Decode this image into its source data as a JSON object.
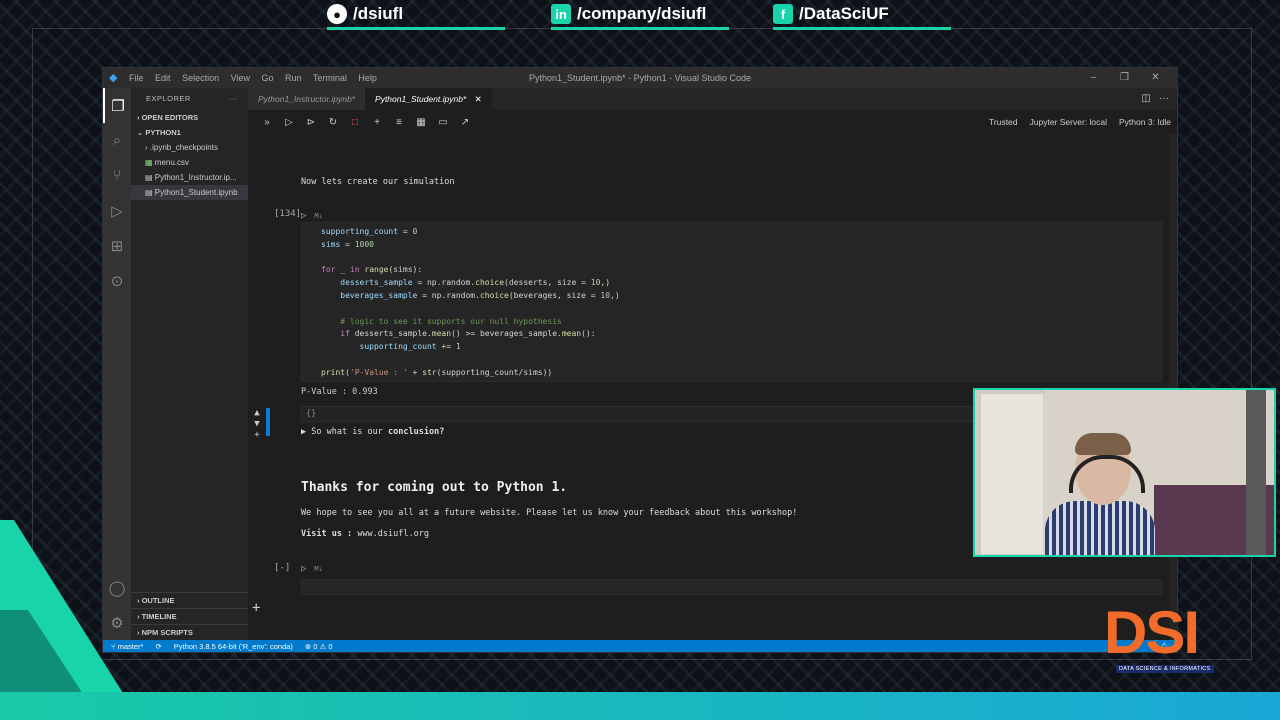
{
  "overlay": {
    "social": [
      {
        "icon": "github-icon",
        "text": "/dsiufl"
      },
      {
        "icon": "linkedin-icon",
        "text": "/company/dsiufl"
      },
      {
        "icon": "facebook-icon",
        "text": "/DataSciUF"
      }
    ],
    "logo_text": "DSI",
    "logo_sub": "DATA SCIENCE & INFORMATICS",
    "accent_color": "#19d3aa",
    "logo_color": "#f36b2a"
  },
  "window": {
    "title": "Python1_Student.ipynb* - Python1 - Visual Studio Code",
    "menu": [
      "File",
      "Edit",
      "Selection",
      "View",
      "Go",
      "Run",
      "Terminal",
      "Help"
    ],
    "controls": [
      "–",
      "❐",
      "✕"
    ]
  },
  "sidebar": {
    "header": "EXPLORER",
    "more": "···",
    "open_editors": "OPEN EDITORS",
    "folder": "PYTHON1",
    "items": [
      {
        "label": ".ipynb_checkpoints",
        "icon": "chevron-right-icon"
      },
      {
        "label": "menu.csv",
        "icon": "csv-file-icon"
      },
      {
        "label": "Python1_Instructor.ip...",
        "icon": "notebook-file-icon"
      },
      {
        "label": "Python1_Student.ipynb",
        "icon": "notebook-file-icon"
      }
    ],
    "bottom": [
      "OUTLINE",
      "TIMELINE",
      "NPM SCRIPTS"
    ]
  },
  "tabs": [
    {
      "label": "Python1_Instructor.ipynb*",
      "active": false
    },
    {
      "label": "Python1_Student.ipynb*",
      "active": true
    }
  ],
  "notebook_status": {
    "trusted": "Trusted",
    "server": "Jupyter Server: local",
    "kernel": "Python 3: Idle"
  },
  "cells": {
    "md1": "Now lets create our simulation",
    "code_exec": "[134]",
    "cell_lang": "M↓",
    "output": "P-Value : 0.993",
    "empty_cell_body": "{}",
    "collapsed": "So what is our",
    "collapsed_bold": "conclusion?",
    "heading": "Thanks for coming out to Python 1.",
    "para": "We hope to see you all at a future website. Please let us know your feedback about this workshop!",
    "visit_label": "Visit us :",
    "visit_url": "www.dsiufl.org",
    "empty_exec": "[-]"
  },
  "statusbar": {
    "branch": "master*",
    "python": "Python 3.8.5 64-bit ('R_env': conda)",
    "problems": "⊗ 0 ⚠ 0"
  }
}
